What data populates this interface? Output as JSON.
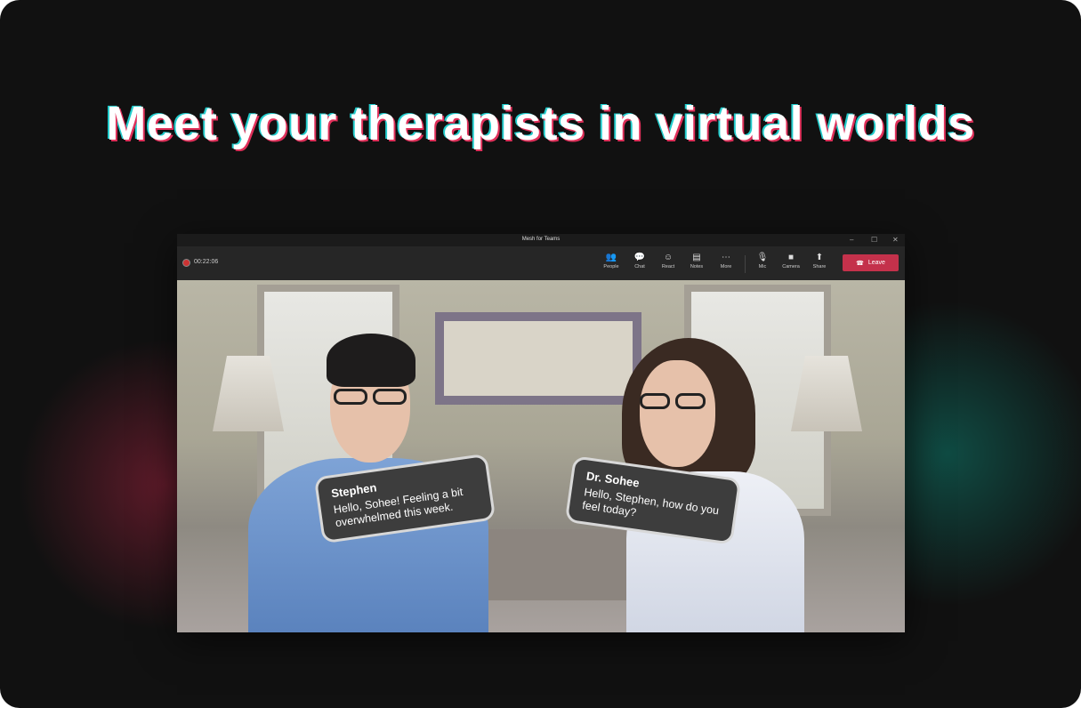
{
  "headline": "Meet your therapists in virtual worlds",
  "window": {
    "title": "Mesh for Teams",
    "minimize": "–",
    "maximize": "☐",
    "close": "✕"
  },
  "toolbar": {
    "timer": "00:22:06",
    "buttons": [
      {
        "label": "People",
        "icon": "people-icon",
        "glyph": "👥"
      },
      {
        "label": "Chat",
        "icon": "chat-icon",
        "glyph": "💬"
      },
      {
        "label": "React",
        "icon": "react-icon",
        "glyph": "☺"
      },
      {
        "label": "Notes",
        "icon": "notes-icon",
        "glyph": "▤"
      },
      {
        "label": "More",
        "icon": "more-icon",
        "glyph": "⋯"
      },
      {
        "label": "Mic",
        "icon": "mic-icon",
        "glyph": "🎙"
      },
      {
        "label": "Camera",
        "icon": "camera-icon",
        "glyph": "■"
      },
      {
        "label": "Share",
        "icon": "share-icon",
        "glyph": "⬆"
      }
    ],
    "leave_label": "Leave",
    "leave_glyph": "☎",
    "leave_color": "#c4314b"
  },
  "bubbles": [
    {
      "name": "Stephen",
      "message": "Hello, Sohee! Feeling a bit overwhelmed this week."
    },
    {
      "name": "Dr. Sohee",
      "message": "Hello, Stephen, how do you feel today?"
    }
  ]
}
